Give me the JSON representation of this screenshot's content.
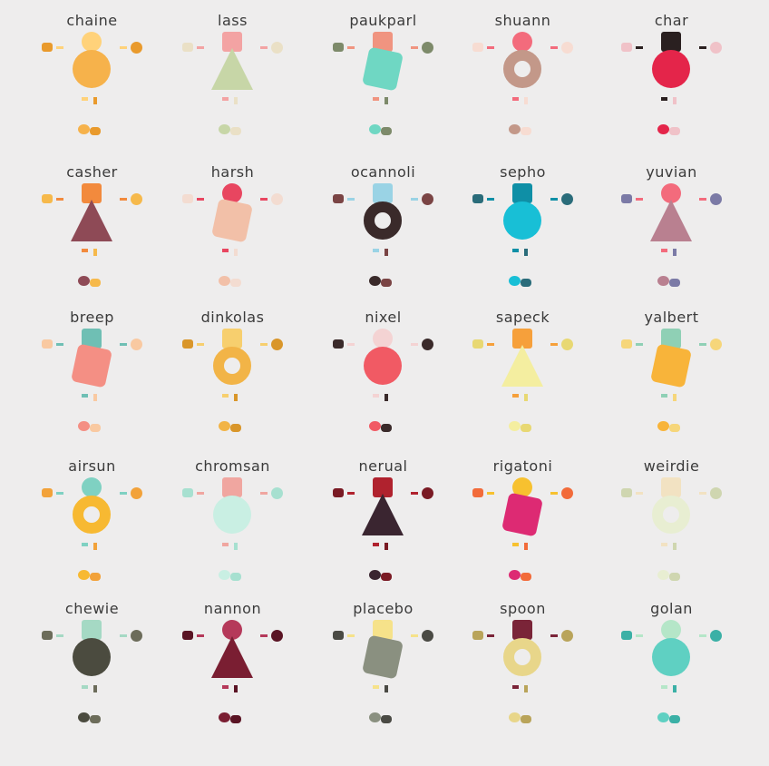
{
  "title": "",
  "characters": [
    {
      "name": "chaine",
      "colors": [
        "#f6b24b",
        "#ffd27a",
        "#e99a2c"
      ]
    },
    {
      "name": "lass",
      "colors": [
        "#c7d6a7",
        "#f3a3a3",
        "#eae0c6"
      ]
    },
    {
      "name": "paukparl",
      "colors": [
        "#6fd7c3",
        "#f09480",
        "#7d8a6a"
      ]
    },
    {
      "name": "shuann",
      "colors": [
        "#c39889",
        "#f36b7c",
        "#f7dcd2"
      ]
    },
    {
      "name": "char",
      "colors": [
        "#e4254a",
        "#2a2020",
        "#f0c2c8"
      ]
    },
    {
      "name": "casher",
      "colors": [
        "#8e4a56",
        "#f28a3d",
        "#f6b94b"
      ]
    },
    {
      "name": "harsh",
      "colors": [
        "#f2c0a8",
        "#e84660",
        "#f3dcd1"
      ]
    },
    {
      "name": "ocannoli",
      "colors": [
        "#3a2a2a",
        "#9ad3e5",
        "#7a4444"
      ]
    },
    {
      "name": "sepho",
      "colors": [
        "#18bfd6",
        "#0f8fa6",
        "#2a6c7a"
      ]
    },
    {
      "name": "yuvian",
      "colors": [
        "#b98090",
        "#f36b7c",
        "#7b7aa6"
      ]
    },
    {
      "name": "breep",
      "colors": [
        "#f48f84",
        "#6fbfb4",
        "#f9c9a1"
      ]
    },
    {
      "name": "dinkolas",
      "colors": [
        "#f2b447",
        "#f7cf6e",
        "#d9962a"
      ]
    },
    {
      "name": "nixel",
      "colors": [
        "#f15a64",
        "#f4d3d3",
        "#3a2a2a"
      ]
    },
    {
      "name": "sapeck",
      "colors": [
        "#f4eea0",
        "#f6a03b",
        "#e8d873"
      ]
    },
    {
      "name": "yalbert",
      "colors": [
        "#f8b43a",
        "#8fd0b5",
        "#f6d67a"
      ]
    },
    {
      "name": "airsun",
      "colors": [
        "#f7b932",
        "#7fd1c2",
        "#f2a23a"
      ]
    },
    {
      "name": "chromsan",
      "colors": [
        "#c9efe3",
        "#f0a6a0",
        "#a7e0d0"
      ]
    },
    {
      "name": "nerual",
      "colors": [
        "#3a2530",
        "#b0222e",
        "#7a1a24"
      ]
    },
    {
      "name": "rigatoni",
      "colors": [
        "#dd2a73",
        "#f7c12f",
        "#f26b3a"
      ]
    },
    {
      "name": "weirdie",
      "colors": [
        "#e8eed2",
        "#f2e2c2",
        "#cfd6b0"
      ]
    },
    {
      "name": "chewie",
      "colors": [
        "#4b4b3f",
        "#a5d9c4",
        "#6c6c5a"
      ]
    },
    {
      "name": "nannon",
      "colors": [
        "#7a1e32",
        "#b5395a",
        "#5a1424"
      ]
    },
    {
      "name": "placebo",
      "colors": [
        "#8a9080",
        "#f6e28a",
        "#4a4a44"
      ]
    },
    {
      "name": "spoon",
      "colors": [
        "#e8d68a",
        "#7a2438",
        "#b9a45a"
      ]
    },
    {
      "name": "golan",
      "colors": [
        "#5fd0c2",
        "#b5e6c8",
        "#3bb0a6"
      ]
    }
  ]
}
